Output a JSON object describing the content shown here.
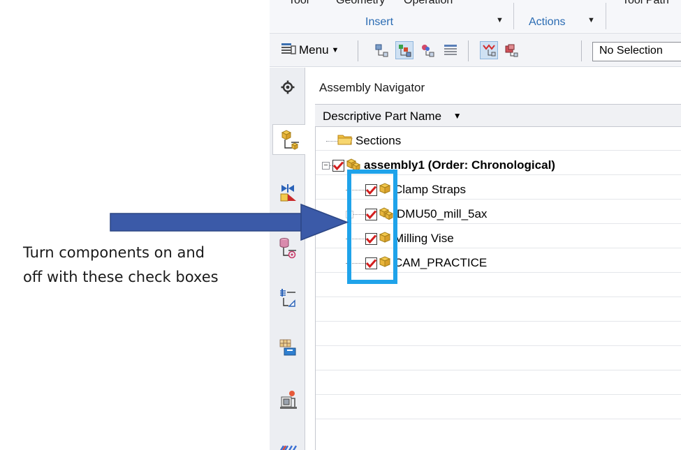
{
  "ribbon": {
    "cut_labels": [
      "Tool",
      "Geometry",
      "Operation",
      "Tool Path"
    ],
    "groups": [
      {
        "label": "Insert"
      },
      {
        "label": "Actions"
      }
    ]
  },
  "toolbar": {
    "menu_label": "Menu",
    "selection_filter": "No Selection"
  },
  "navigator": {
    "title": "Assembly Navigator",
    "column_header": "Descriptive Part Name",
    "tree": {
      "sections_label": "Sections",
      "root_label": "assembly1 (Order: Chronological)",
      "components": [
        {
          "label": "Clamp Straps",
          "checked": true,
          "is_assembly": false
        },
        {
          "label": "DMU50_mill_5ax",
          "checked": true,
          "is_assembly": true
        },
        {
          "label": "Milling Vise",
          "checked": true,
          "is_assembly": false
        },
        {
          "label": "CAM_PRACTICE",
          "checked": true,
          "is_assembly": false
        }
      ]
    }
  },
  "annotation": {
    "text": "Turn components on and\noff with these check boxes",
    "arrow_color": "#3b5aa8",
    "highlight_color": "#1fa3ea"
  },
  "colors": {
    "checkmark": "#d31e1e",
    "part_icon": "#e8b53c",
    "ribbon_group_text": "#2b6cb3"
  }
}
